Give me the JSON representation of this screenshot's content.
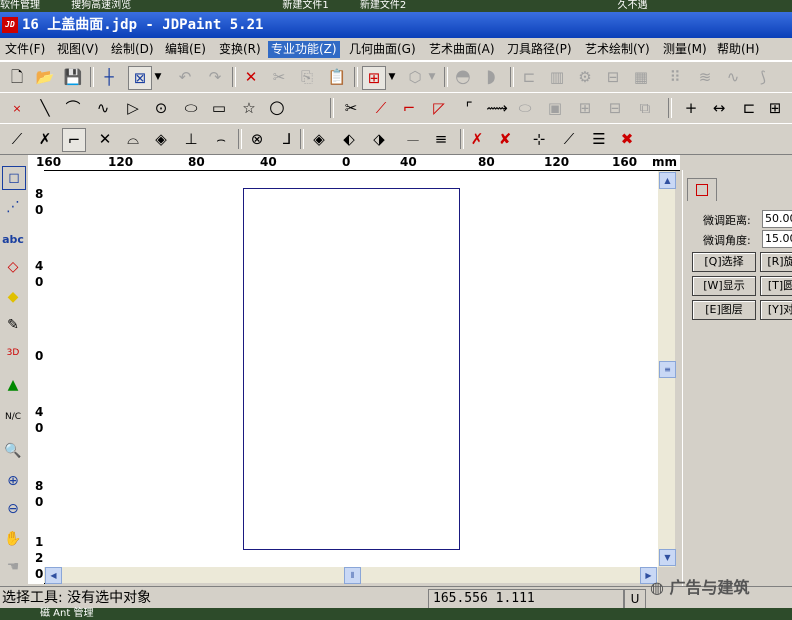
{
  "desktop_labels": [
    "软件管理",
    "搜狗高速浏览",
    "新建文件1",
    "新建文件2",
    "久不遇"
  ],
  "window": {
    "title": "16 上盖曲面.jdp - JDPaint 5.21",
    "logo": "JD"
  },
  "menu": [
    {
      "label": "文件(F)"
    },
    {
      "label": "视图(V)"
    },
    {
      "label": "绘制(D)"
    },
    {
      "label": "编辑(E)"
    },
    {
      "label": "变换(R)"
    },
    {
      "label": "专业功能(Z)"
    },
    {
      "label": "几何曲面(G)"
    },
    {
      "label": "艺术曲面(A)"
    },
    {
      "label": "刀具路径(P)"
    },
    {
      "label": "艺术绘制(Y)"
    },
    {
      "label": "测量(M)"
    },
    {
      "label": "帮助(H)"
    }
  ],
  "active_menu": "专业功能(Z)",
  "hruler_labels": [
    "160",
    "120",
    "80",
    "40",
    "0",
    "40",
    "80",
    "120",
    "160",
    "mm"
  ],
  "vruler_labels": [
    "8",
    "0",
    "4",
    "0",
    "0",
    "4",
    "0",
    "8",
    "0",
    "1",
    "2",
    "0"
  ],
  "panel": {
    "distance_label": "微调距离:",
    "distance_value": "50.00",
    "angle_label": "微调角度:",
    "angle_value": "15.00",
    "buttons": [
      "[Q]选择",
      "[R]旋",
      "[W]显示",
      "[T]圆",
      "[E]图层",
      "[Y]对"
    ]
  },
  "status": {
    "message": "选择工具: 没有选中对象",
    "coords": "165.556 1.111",
    "unit": "U"
  },
  "watermark": "广告与建筑",
  "taskbar_text": "磁 Ant 管理"
}
